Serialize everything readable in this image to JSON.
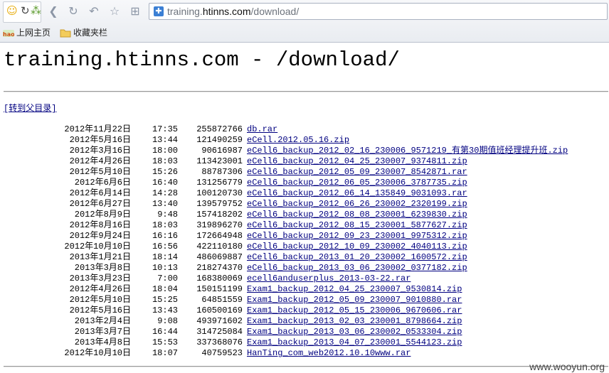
{
  "browser": {
    "url_host_prefix": "training.",
    "url_host_main": "htinns.com",
    "url_path": "/download/",
    "bookmarks": [
      {
        "label": "上网主页",
        "icon": "hao-home-icon"
      },
      {
        "label": "收藏夹栏",
        "icon": "folder-icon"
      }
    ],
    "logo_text": "hao"
  },
  "page": {
    "title": "training.htinns.com - /download/",
    "parent_link": "[转到父目录]"
  },
  "files": [
    {
      "date": "2012年11月22日",
      "time": "17:35",
      "size": "255872766",
      "name": "db.rar"
    },
    {
      "date": "2012年5月16日",
      "time": "13:44",
      "size": "121490259",
      "name": "eCell.2012.05.16.zip"
    },
    {
      "date": "2012年3月16日",
      "time": "18:00",
      "size": "90616987",
      "name": "eCell6_backup_2012_02_16_230006_9571219_有第30期值班经理提升班.zip"
    },
    {
      "date": "2012年4月26日",
      "time": "18:03",
      "size": "113423001",
      "name": "eCell6_backup_2012_04_25_230007_9374811.zip"
    },
    {
      "date": "2012年5月10日",
      "time": "15:26",
      "size": "88787306",
      "name": "eCell6_backup_2012_05_09_230007_8542871.rar"
    },
    {
      "date": "2012年6月6日",
      "time": "16:40",
      "size": "131256779",
      "name": "eCell6_backup_2012_06_05_230006_3787735.zip"
    },
    {
      "date": "2012年6月14日",
      "time": "14:28",
      "size": "100120730",
      "name": "eCell6_backup_2012_06_14_135849_9031093.rar"
    },
    {
      "date": "2012年6月27日",
      "time": "13:40",
      "size": "139579752",
      "name": "eCell6_backup_2012_06_26_230002_2320199.zip"
    },
    {
      "date": "2012年8月9日",
      "time": "9:48",
      "size": "157418202",
      "name": "eCell6_backup_2012_08_08_230001_6239830.zip"
    },
    {
      "date": "2012年8月16日",
      "time": "18:03",
      "size": "319896270",
      "name": "eCell6_backup_2012_08_15_230001_5877627.zip"
    },
    {
      "date": "2012年9月24日",
      "time": "16:16",
      "size": "172664948",
      "name": "eCell6_backup_2012_09_23_230001_9975312.zip"
    },
    {
      "date": "2012年10月10日",
      "time": "16:56",
      "size": "422110180",
      "name": "eCell6_backup_2012_10_09_230002_4040113.zip"
    },
    {
      "date": "2013年1月21日",
      "time": "18:14",
      "size": "486069887",
      "name": "eCell6_backup_2013_01_20_230002_1600572.zip"
    },
    {
      "date": "2013年3月8日",
      "time": "10:13",
      "size": "218274370",
      "name": "eCell6_backup_2013_03_06_230002_0377182.zip"
    },
    {
      "date": "2013年3月23日",
      "time": "7:00",
      "size": "168380069",
      "name": "ecell6anduserplus_2013-03-22.rar"
    },
    {
      "date": "2012年4月26日",
      "time": "18:04",
      "size": "150151199",
      "name": "Exam1_backup_2012_04_25_230007_9530814.zip"
    },
    {
      "date": "2012年5月10日",
      "time": "15:25",
      "size": "64851559",
      "name": "Exam1_backup_2012_05_09_230007_9010880.rar"
    },
    {
      "date": "2012年5月16日",
      "time": "13:43",
      "size": "160500169",
      "name": "Exam1_backup_2012_05_15_230006_9670606.rar"
    },
    {
      "date": "2013年2月4日",
      "time": "9:08",
      "size": "493971602",
      "name": "Exam1_backup_2013_02_03_230001_8798664.zip"
    },
    {
      "date": "2013年3月7日",
      "time": "16:44",
      "size": "314725084",
      "name": "Exam1_backup_2013_03_06_230002_0533304.zip"
    },
    {
      "date": "2013年4月8日",
      "time": "15:53",
      "size": "337368076",
      "name": "Exam1_backup_2013_04_07_230001_5544123.zip"
    },
    {
      "date": "2012年10月10日",
      "time": "18:07",
      "size": "40759523",
      "name": "HanTing_com_web2012.10.10www.rar"
    }
  ],
  "watermark": "www.wooyun.org",
  "colors": {
    "link": "#000080",
    "text": "#000000",
    "icon_blue": "#3b7fd4"
  }
}
